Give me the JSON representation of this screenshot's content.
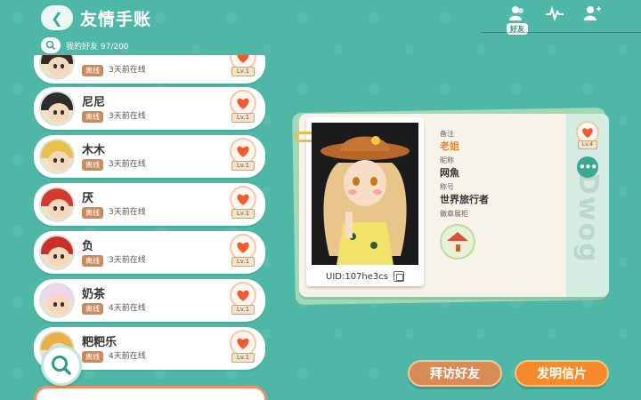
{
  "header": {
    "back_icon": "back-arrow-icon",
    "title": "友情手账",
    "friend_count_label": "我的好友 97/200",
    "tabs": [
      {
        "name": "friends",
        "icon": "people-icon",
        "label": "好友"
      },
      {
        "name": "activity",
        "icon": "pulse-icon",
        "label": ""
      },
      {
        "name": "add-friend",
        "icon": "person-add-icon",
        "label": ""
      }
    ]
  },
  "friends": [
    {
      "name": "",
      "status": "离线",
      "last_online": "3天前在线",
      "level": "Lv.1",
      "hair_color": "#3a2a22"
    },
    {
      "name": "尼尼",
      "status": "离线",
      "last_online": "3天前在线",
      "level": "Lv.1",
      "hair_color": "#2d2d2d"
    },
    {
      "name": "木木",
      "status": "离线",
      "last_online": "3天前在线",
      "level": "Lv.1",
      "hair_color": "#e7c24a"
    },
    {
      "name": "厌",
      "status": "离线",
      "last_online": "3天前在线",
      "level": "Lv.1",
      "hair_color": "#d63a2e"
    },
    {
      "name": "负",
      "status": "离线",
      "last_online": "3天前在线",
      "level": "Lv.1",
      "hair_color": "#c9302c"
    },
    {
      "name": "奶茶",
      "status": "离线",
      "last_online": "4天前在线",
      "level": "Lv.1",
      "hair_color": "#f1d5ea"
    },
    {
      "name": "粑粑乐",
      "status": "离线",
      "last_online": "4天前在线",
      "level": "Lv.1",
      "hair_color": "#e8b045"
    }
  ],
  "card": {
    "uid": "UID:107he3cs",
    "remark_label": "备注",
    "remark": "老姐",
    "nickname_label": "昵称",
    "nickname": "网魚",
    "title_label": "称号",
    "title": "世界旅行者",
    "badge_label": "徽章展柜",
    "level": "Lv.4",
    "more_icon": "more-dots-icon",
    "spine_text": "Dwog"
  },
  "buttons": {
    "visit": "拜访好友",
    "postcard": "发明信片"
  },
  "colors": {
    "background": "#4fb7a6",
    "accent_orange": "#f38b2c",
    "offline_badge": "#c98a5c"
  }
}
